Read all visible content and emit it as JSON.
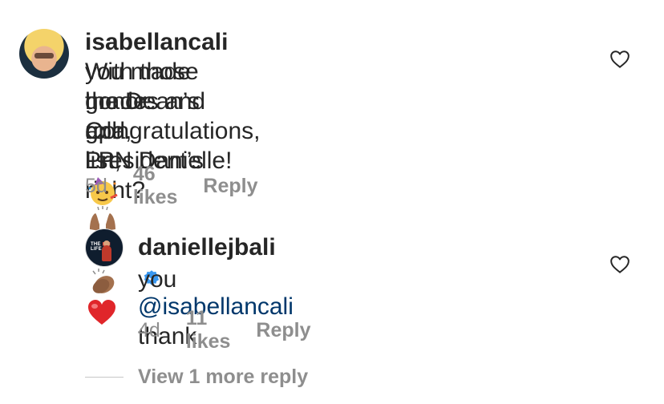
{
  "comments": [
    {
      "username": "isabellancali",
      "text_line1": " With those grades and gpa,",
      "text_line2": "you made the Dean’s and President’s",
      "text_line3": "honor roll list, right?",
      "text_line4": "Congratulations, LPN Danielle!",
      "emojis_line3": [
        "raising-hands-emoji",
        "clapping-hands-emoji",
        "clapping-hands-emoji",
        "red-heart-emoji"
      ],
      "emoji_line4": "partying-face-emoji",
      "time": "5d",
      "likes": "46 likes",
      "reply": "Reply"
    },
    {
      "username": "daniellejbali",
      "verified": true,
      "mention": "@isabellancali",
      "text_line1": " thank",
      "text_line2": "you",
      "time": "4d",
      "likes": "11 likes",
      "reply": "Reply"
    }
  ],
  "view_more": "View 1 more reply",
  "colors": {
    "text": "#262626",
    "secondary": "#8e8e8e",
    "mention": "#00376b",
    "verified": "#3897f0"
  }
}
